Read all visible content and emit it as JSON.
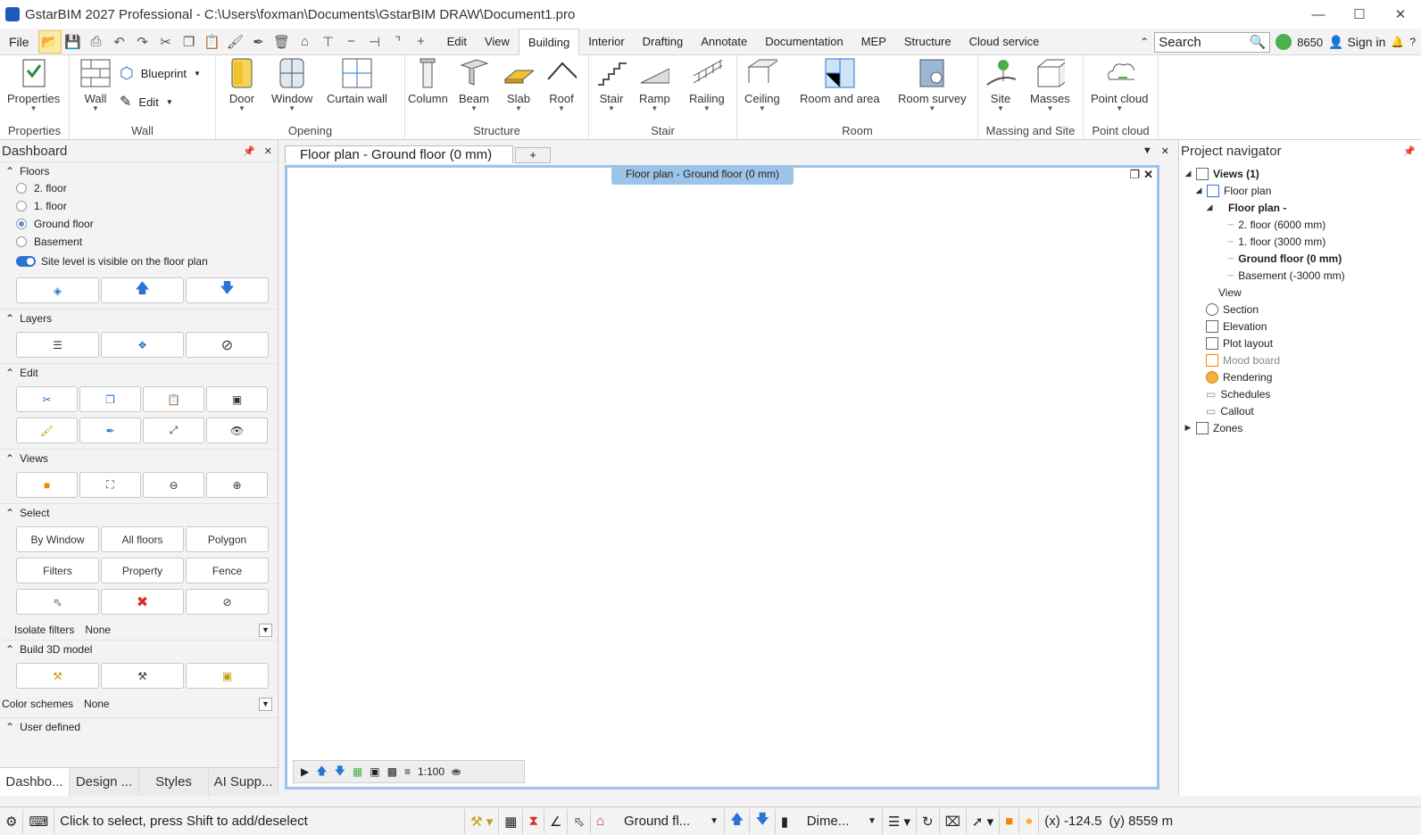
{
  "window": {
    "title": "GstarBIM  2027 Professional - C:\\Users\\foxman\\Documents\\GstarBIM DRAW\\Document1.pro",
    "minimize": "—",
    "maximize": "☐",
    "close": "✕"
  },
  "menubar": {
    "file": "File",
    "tabs": [
      "Edit",
      "View",
      "Building",
      "Interior",
      "Drafting",
      "Annotate",
      "Documentation",
      "MEP",
      "Structure",
      "Cloud service"
    ],
    "active_tab": "Building",
    "search_placeholder": "Search",
    "credits": "8650",
    "sign_in": "Sign in",
    "help": "?"
  },
  "ribbon": {
    "groups": [
      {
        "label": "Properties",
        "buttons": [
          "Properties"
        ]
      },
      {
        "label": "Wall",
        "buttons": [
          "Wall"
        ],
        "small": [
          "Blueprint",
          "Edit"
        ]
      },
      {
        "label": "Opening",
        "buttons": [
          "Door",
          "Window",
          "Curtain wall"
        ]
      },
      {
        "label": "Structure",
        "buttons": [
          "Column",
          "Beam",
          "Slab",
          "Roof"
        ]
      },
      {
        "label": "Stair",
        "buttons": [
          "Stair",
          "Ramp",
          "Railing"
        ]
      },
      {
        "label": "Room",
        "buttons": [
          "Ceiling",
          "Room and area",
          "Room survey"
        ]
      },
      {
        "label": "Massing and Site",
        "buttons": [
          "Site",
          "Masses"
        ]
      },
      {
        "label": "Point cloud",
        "buttons": [
          "Point cloud"
        ]
      }
    ]
  },
  "dashboard": {
    "title": "Dashboard",
    "floors_header": "Floors",
    "floors": [
      "2. floor",
      "1. floor",
      "Ground floor",
      "Basement"
    ],
    "selected_floor": "Ground floor",
    "site_toggle": "Site level is visible on the floor plan",
    "layers_header": "Layers",
    "edit_header": "Edit",
    "views_header": "Views",
    "select_header": "Select",
    "select_buttons": [
      "By Window",
      "All floors",
      "Polygon",
      "Filters",
      "Property",
      "Fence"
    ],
    "isolate_label": "Isolate filters",
    "isolate_value": "None",
    "build_header": "Build 3D model",
    "color_label": "Color schemes",
    "color_value": "None",
    "user_header": "User defined",
    "bottom_tabs": [
      "Dashbo...",
      "Design ...",
      "Styles",
      "AI Supp..."
    ]
  },
  "main": {
    "doc_tab": "Floor plan - Ground floor (0 mm)",
    "plus": "+",
    "canvas_label": "Floor plan - Ground floor (0 mm)",
    "scale": "1:100"
  },
  "navigator": {
    "title": "Project navigator",
    "views_root": "Views (1)",
    "floor_plan": "Floor plan",
    "floor_plan_sub": "Floor plan -",
    "floors": [
      "2. floor (6000 mm)",
      "1. floor (3000 mm)",
      "Ground floor (0 mm)",
      "Basement (-3000 mm)"
    ],
    "bold_floor": "Ground floor (0 mm)",
    "items": [
      "View",
      "Section",
      "Elevation",
      "Plot layout",
      "Mood board",
      "Rendering",
      "Schedules",
      "Callout"
    ],
    "zones": "Zones"
  },
  "statusbar": {
    "hint": "Click to select, press Shift to add/deselect",
    "floor": "Ground fl...",
    "dim": "Dime...",
    "x": "(x) -124.5",
    "y": "(y) 8559 m"
  },
  "colors": {
    "accent": "#2a74d6",
    "canvas_border": "#9cc4e8",
    "active_tab_bg": "#ffffff"
  }
}
